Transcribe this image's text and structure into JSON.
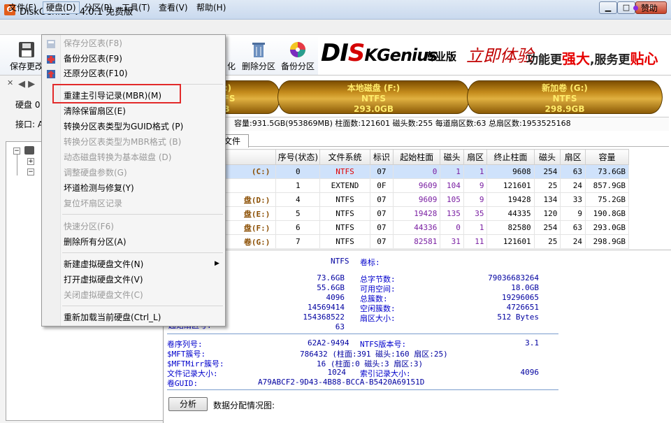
{
  "window": {
    "title": "DiskGenius V4.0.1 免费版",
    "icon": "G",
    "min": "▁",
    "max": "□",
    "close": "✕"
  },
  "menu": {
    "items": [
      "文件(F)",
      "硬盘(D)",
      "分区(P)",
      "工具(T)",
      "查看(V)",
      "帮助(H)"
    ],
    "donate": "赞助"
  },
  "toolbar": {
    "save_label": "保存更改",
    "partial_label": "化",
    "delete_label": "删除分区",
    "backup_label": "备份分区"
  },
  "banner": {
    "logo_a": "DI",
    "logo_b": "S",
    "logo_c": "KGenius",
    "pro": "专业版",
    "slogan1": "立即体验",
    "slogan2a": "功能更",
    "slogan2b": "强大",
    "slogan2c": ",服务更",
    "slogan2d": "贴心"
  },
  "left": {
    "disk": "硬盘 0",
    "iface": "接口: A"
  },
  "diskmap": [
    {
      "name": "(E:)",
      "fs": "NTFS",
      "size": "GB"
    },
    {
      "name": "本地磁盘 (F:)",
      "fs": "NTFS",
      "size": "293.0GB"
    },
    {
      "name": "新加卷 (G:)",
      "fs": "NTFS",
      "size": "298.9GB"
    }
  ],
  "diskinfo": "容量:931.5GB(953869MB)   柱面数:121601   磁头数:255   每道扇区数:63   总扇区数:1953525168",
  "tabs": {
    "files": "文件"
  },
  "table": {
    "headers": [
      "序号(状态)",
      "文件系统",
      "标识",
      "起始柱面",
      "磁头",
      "扇区",
      "终止柱面",
      "磁头",
      "扇区",
      "容量"
    ],
    "rows": [
      {
        "name": "(C:)",
        "seq": "0",
        "fs": "NTFS",
        "id": "07",
        "sc": "0",
        "sh": "1",
        "ss": "1",
        "ec": "9608",
        "eh": "254",
        "es": "63",
        "cap": "73.6GB"
      },
      {
        "name": "",
        "seq": "1",
        "fs": "EXTEND",
        "id": "0F",
        "sc": "9609",
        "sh": "104",
        "ss": "9",
        "ec": "121601",
        "eh": "25",
        "es": "24",
        "cap": "857.9GB"
      },
      {
        "name": "盘(D:)",
        "seq": "4",
        "fs": "NTFS",
        "id": "07",
        "sc": "9609",
        "sh": "105",
        "ss": "9",
        "ec": "19428",
        "eh": "134",
        "es": "33",
        "cap": "75.2GB"
      },
      {
        "name": "盘(E:)",
        "seq": "5",
        "fs": "NTFS",
        "id": "07",
        "sc": "19428",
        "sh": "135",
        "ss": "35",
        "ec": "44335",
        "eh": "120",
        "es": "9",
        "cap": "190.8GB"
      },
      {
        "name": "盘(F:)",
        "seq": "6",
        "fs": "NTFS",
        "id": "07",
        "sc": "44336",
        "sh": "0",
        "ss": "1",
        "ec": "82580",
        "eh": "254",
        "es": "63",
        "cap": "293.0GB"
      },
      {
        "name": "卷(G:)",
        "seq": "7",
        "fs": "NTFS",
        "id": "07",
        "sc": "82581",
        "sh": "31",
        "ss": "11",
        "ec": "121601",
        "eh": "25",
        "es": "24",
        "cap": "298.9GB"
      }
    ]
  },
  "detail": {
    "fs": "NTFS",
    "vol_label": "卷标:",
    "left_values": [
      "73.6GB",
      "55.6GB",
      "4096",
      "14569414",
      "154368522",
      "63"
    ],
    "right_labels": [
      "总字节数:",
      "可用空间:",
      "总簇数:",
      "空闲簇数:",
      "扇区大小:"
    ],
    "right_values": [
      "79036683264",
      "18.0GB",
      "19296065",
      "4726651",
      "512 Bytes"
    ],
    "cut_label": "起始扇区号:",
    "serial_label": "卷序列号:",
    "serial": "62A2-9494",
    "ntfsver_label": "NTFS版本号:",
    "ntfsver": "3.1",
    "mft_label": "$MFT簇号:",
    "mft": "786432 (柱面:391 磁头:160 扇区:25)",
    "mftmirr_label": "$MFTMirr簇号:",
    "mftmirr": "16 (柱面:0 磁头:3 扇区:3)",
    "frs_label": "文件记录大小:",
    "frs": "1024",
    "irs_label": "索引记录大小:",
    "irs": "4096",
    "guid_label": "卷GUID:",
    "guid": "A79ABCF2-9D43-4B88-BCCA-B5420A69151D",
    "analyze": "分析",
    "alloc_label": "数据分配情况图:"
  },
  "dropdown": {
    "items": [
      {
        "label": "保存分区表(F8)",
        "disabled": true
      },
      {
        "label": "备份分区表(F9)",
        "disabled": false
      },
      {
        "label": "还原分区表(F10)",
        "disabled": false
      },
      {
        "label": "重建主引导记录(MBR)(M)",
        "disabled": false
      },
      {
        "label": "清除保留扇区(E)",
        "disabled": false
      },
      {
        "label": "转换分区表类型为GUID格式 (P)",
        "disabled": false
      },
      {
        "label": "转换分区表类型为MBR格式 (B)",
        "disabled": true
      },
      {
        "label": "动态磁盘转换为基本磁盘 (D)",
        "disabled": true
      },
      {
        "label": "调整硬盘参数(G)",
        "disabled": true
      },
      {
        "label": "坏道检测与修复(Y)",
        "disabled": false
      },
      {
        "label": "复位坏扇区记录",
        "disabled": true
      },
      {
        "label": "快速分区(F6)",
        "disabled": true
      },
      {
        "label": "删除所有分区(A)",
        "disabled": false
      },
      {
        "label": "新建虚拟硬盘文件(N)",
        "disabled": false
      },
      {
        "label": "打开虚拟硬盘文件(V)",
        "disabled": false
      },
      {
        "label": "关闭虚拟硬盘文件(C)",
        "disabled": true
      },
      {
        "label": "重新加载当前硬盘(Ctrl_L)",
        "disabled": false
      }
    ]
  }
}
